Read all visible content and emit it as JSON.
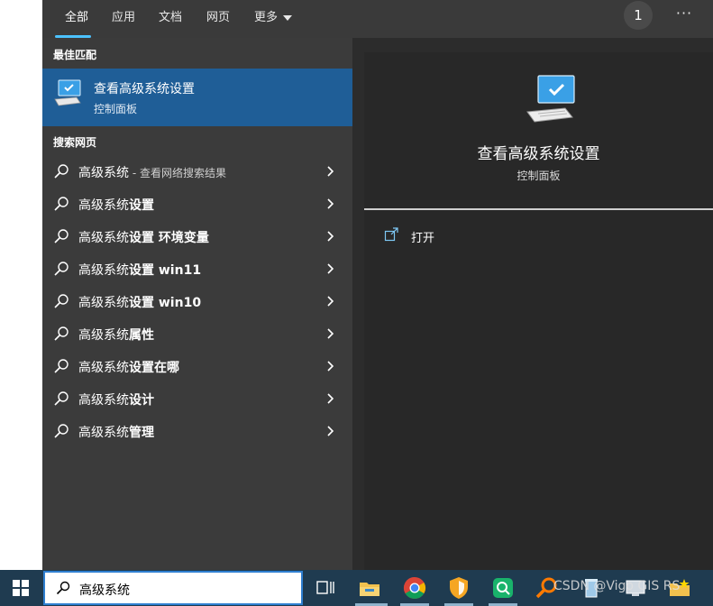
{
  "tabs": [
    {
      "label": "全部"
    },
    {
      "label": "应用"
    },
    {
      "label": "文档"
    },
    {
      "label": "网页"
    },
    {
      "label": "更多"
    }
  ],
  "badge_count": "1",
  "more_options_label": "···",
  "best_match": {
    "section_title": "最佳匹配",
    "title": "查看高级系统设置",
    "subtitle": "控制面板",
    "icon": "monitor-settings-icon"
  },
  "web_search": {
    "section_title": "搜索网页",
    "items": [
      {
        "prefix": "高级系统",
        "suffix": "",
        "hint": " - 查看网络搜索结果"
      },
      {
        "prefix": "高级系统",
        "suffix": "设置",
        "hint": ""
      },
      {
        "prefix": "高级系统",
        "suffix": "设置 环境变量",
        "hint": ""
      },
      {
        "prefix": "高级系统",
        "suffix": "设置 win11",
        "hint": ""
      },
      {
        "prefix": "高级系统",
        "suffix": "设置 win10",
        "hint": ""
      },
      {
        "prefix": "高级系统",
        "suffix": "属性",
        "hint": ""
      },
      {
        "prefix": "高级系统",
        "suffix": "设置在哪",
        "hint": ""
      },
      {
        "prefix": "高级系统",
        "suffix": "设计",
        "hint": ""
      },
      {
        "prefix": "高级系统",
        "suffix": "管理",
        "hint": ""
      }
    ]
  },
  "detail": {
    "title": "查看高级系统设置",
    "subtitle": "控制面板",
    "open_label": "打开"
  },
  "taskbar": {
    "search_text": "高级系统",
    "watermark": "CSDN @Vigo GIS RS",
    "icons": [
      "task-view-icon",
      "file-explorer-icon",
      "chrome-icon",
      "security-shield-icon",
      "green-app-icon",
      "search-tool-icon",
      "recycle-bin-icon",
      "network-icon",
      "folder-star-icon"
    ]
  },
  "colors": {
    "accent": "#4cc2ff",
    "selection": "#1f5e97",
    "taskbar": "#1f3b50"
  }
}
